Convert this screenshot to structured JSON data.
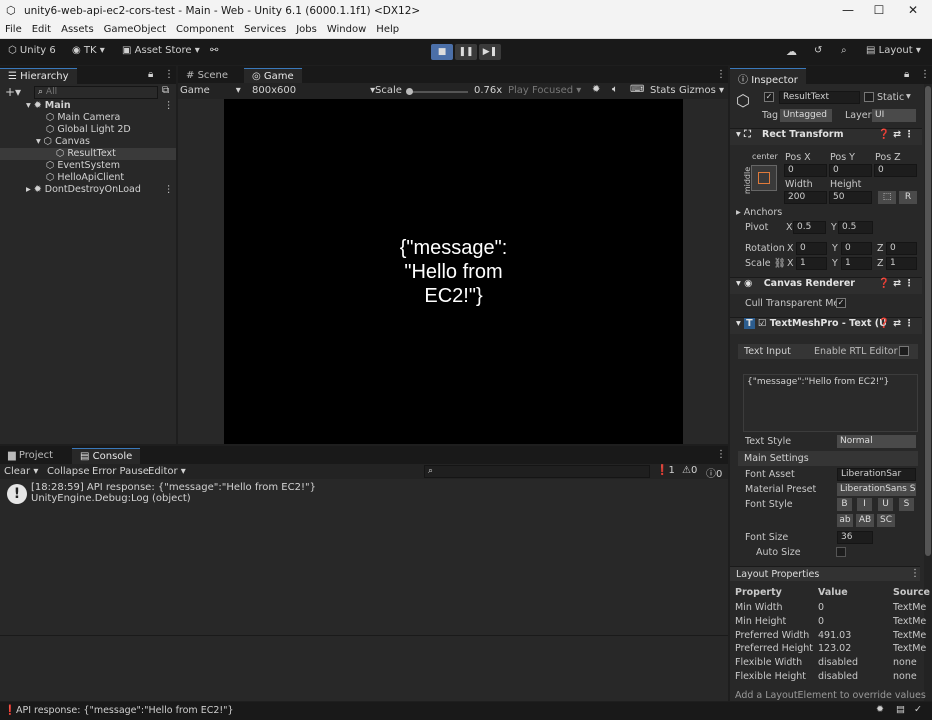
{
  "window": {
    "title": "unity6-web-api-ec2-cors-test - Main - Web - Unity 6.1 (6000.1.1f1) <DX12>",
    "min": "—",
    "max": "☐",
    "close": "✕"
  },
  "menu": [
    "File",
    "Edit",
    "Assets",
    "GameObject",
    "Component",
    "Services",
    "Jobs",
    "Window",
    "Help"
  ],
  "toolbar": {
    "unity": "Unity 6",
    "account": "TK",
    "store": "Asset Store",
    "layout": "Layout"
  },
  "hierarchy": {
    "tab": "Hierarchy",
    "search_placeholder": "All",
    "items": [
      "Main",
      "Main Camera",
      "Global Light 2D",
      "Canvas",
      "ResultText",
      "EventSystem",
      "HelloApiClient",
      "DontDestroyOnLoad"
    ]
  },
  "game": {
    "tab_scene": "Scene",
    "tab_game": "Game",
    "display": "Game",
    "resolution": "800x600",
    "scale_label": "Scale",
    "scale_value": "0.76x",
    "play_focused": "Play Focused",
    "stats": "Stats",
    "gizmos": "Gizmos",
    "text": "{\"message\":\n\"Hello from\nEC2!\"}"
  },
  "console": {
    "tab_project": "Project",
    "tab_console": "Console",
    "clear": "Clear",
    "collapse": "Collapse",
    "error_pause": "Error Pause",
    "editor": "Editor",
    "count_log": "1",
    "count_warn": "0",
    "count_err": "0",
    "log_line1": "[18:28:59] API response: {\"message\":\"Hello from EC2!\"}",
    "log_line2": "UnityEngine.Debug:Log (object)"
  },
  "inspector": {
    "tab": "Inspector",
    "object_name": "ResultText",
    "static": "Static",
    "tag_label": "Tag",
    "tag_value": "Untagged",
    "layer_label": "Layer",
    "layer_value": "UI",
    "rect": {
      "title": "Rect Transform",
      "center": "center",
      "middle": "middle",
      "posx": "Pos X",
      "posy": "Pos Y",
      "posz": "Pos Z",
      "posx_v": "0",
      "posy_v": "0",
      "posz_v": "0",
      "width": "Width",
      "height": "Height",
      "width_v": "200",
      "height_v": "50",
      "anchors": "Anchors",
      "pivot": "Pivot",
      "pivot_x": "0.5",
      "pivot_y": "0.5",
      "rotation": "Rotation",
      "rot_x": "0",
      "rot_y": "0",
      "rot_z": "0",
      "scale": "Scale",
      "sc_x": "1",
      "sc_y": "1",
      "sc_z": "1",
      "x": "X",
      "y": "Y",
      "z": "Z",
      "r": "R"
    },
    "canvas_renderer": {
      "title": "Canvas Renderer",
      "cull": "Cull Transparent Mes"
    },
    "tmp": {
      "title": "TextMeshPro - Text (U",
      "text_input": "Text Input",
      "rtl": "Enable RTL Editor",
      "text_value": "{\"message\":\"Hello from EC2!\"}",
      "text_style": "Text Style",
      "text_style_v": "Normal",
      "main_settings": "Main Settings",
      "font_asset": "Font Asset",
      "font_asset_v": "LiberationSar",
      "material": "Material Preset",
      "material_v": "LiberationSans S",
      "font_style": "Font Style",
      "fs": [
        "B",
        "I",
        "U",
        "S",
        "ab",
        "AB",
        "SC"
      ],
      "font_size": "Font Size",
      "font_size_v": "36",
      "auto_size": "Auto Size"
    },
    "layout": {
      "title": "Layout Properties",
      "headers": [
        "Property",
        "Value",
        "Source"
      ],
      "rows": [
        [
          "Min Width",
          "0",
          "TextMe"
        ],
        [
          "Min Height",
          "0",
          "TextMe"
        ],
        [
          "Preferred Width",
          "491.03",
          "TextMe"
        ],
        [
          "Preferred Height",
          "123.02",
          "TextMe"
        ],
        [
          "Flexible Width",
          "disabled",
          "none"
        ],
        [
          "Flexible Height",
          "disabled",
          "none"
        ]
      ],
      "footer": "Add a LayoutElement to override values"
    }
  },
  "status": {
    "text": "API response: {\"message\":\"Hello from EC2!\"}"
  }
}
